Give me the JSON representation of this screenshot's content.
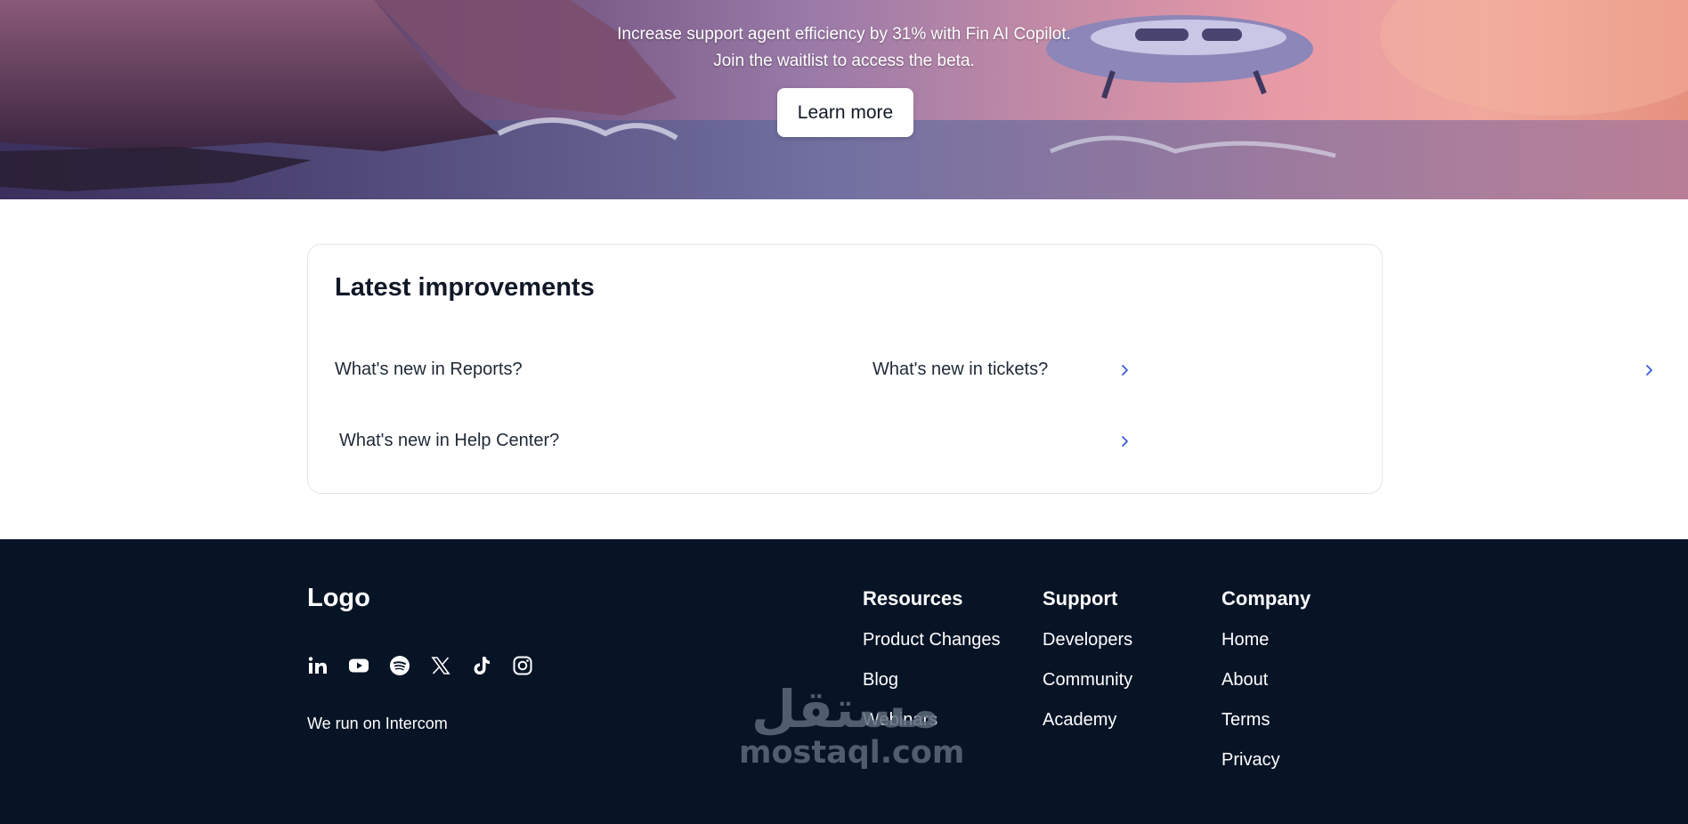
{
  "hero": {
    "line1": "Increase support agent efficiency by 31% with Fin AI Copilot.",
    "line2": "Join the waitlist to access the beta.",
    "cta_label": "Learn more"
  },
  "improvements": {
    "title": "Latest improvements",
    "items": [
      {
        "label": "What's new in Reports?",
        "icon": "chevron-right-icon"
      },
      {
        "label": "What's new in tickets?",
        "icon": "chevron-right-icon"
      },
      {
        "label": "What's new in Help Center?",
        "icon": "chevron-right-icon"
      }
    ],
    "accent_color": "#3b5bdb"
  },
  "footer": {
    "logo": "Logo",
    "socials": [
      "linkedin-icon",
      "youtube-icon",
      "spotify-icon",
      "x-icon",
      "tiktok-icon",
      "instagram-icon"
    ],
    "tagline": "We run on Intercom",
    "columns": [
      {
        "title": "Resources",
        "links": [
          "Product Changes",
          "Blog",
          "Webinars"
        ]
      },
      {
        "title": "Support",
        "links": [
          "Developers",
          "Community",
          "Academy"
        ]
      },
      {
        "title": "Company",
        "links": [
          "Home",
          "About",
          "Terms",
          "Privacy"
        ]
      }
    ],
    "background_color": "#071426"
  },
  "watermark": {
    "arabic": "مستقل",
    "latin": "mostaql.com"
  }
}
